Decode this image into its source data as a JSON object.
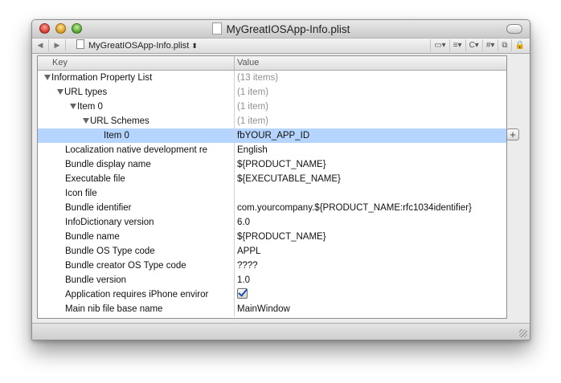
{
  "window": {
    "title": "MyGreatIOSApp-Info.plist"
  },
  "navbar": {
    "back_icon": "◀",
    "forward_icon": "▶",
    "breadcrumb": "MyGreatIOSApp-Info.plist",
    "breadcrumb_arrows": "⬍",
    "tools": [
      "▭▾",
      "≡▾",
      "C▾",
      "#▾",
      "⧉",
      "🔒"
    ]
  },
  "table": {
    "headers": {
      "key": "Key",
      "value": "Value"
    },
    "rows": [
      {
        "key": "Information Property List",
        "value": "(13 items)"
      },
      {
        "key": "URL types",
        "value": "(1 item)"
      },
      {
        "key": "Item 0",
        "value": "(1 item)"
      },
      {
        "key": "URL Schemes",
        "value": "(1 item)"
      },
      {
        "key": "Item 0",
        "value": "fbYOUR_APP_ID"
      },
      {
        "key": "Localization native development re",
        "value": "English"
      },
      {
        "key": "Bundle display name",
        "value": "${PRODUCT_NAME}"
      },
      {
        "key": "Executable file",
        "value": "${EXECUTABLE_NAME}"
      },
      {
        "key": "Icon file",
        "value": ""
      },
      {
        "key": "Bundle identifier",
        "value": "com.yourcompany.${PRODUCT_NAME:rfc1034identifier}"
      },
      {
        "key": "InfoDictionary version",
        "value": "6.0"
      },
      {
        "key": "Bundle name",
        "value": "${PRODUCT_NAME}"
      },
      {
        "key": "Bundle OS Type code",
        "value": "APPL"
      },
      {
        "key": "Bundle creator OS Type code",
        "value": "????"
      },
      {
        "key": "Bundle version",
        "value": "1.0"
      },
      {
        "key": "Application requires iPhone enviror",
        "value": ""
      },
      {
        "key": "Main nib file base name",
        "value": "MainWindow"
      }
    ]
  },
  "add_button": "+",
  "colors": {
    "selection": "#b5d5ff",
    "checkmark": "#1c4fb5"
  }
}
